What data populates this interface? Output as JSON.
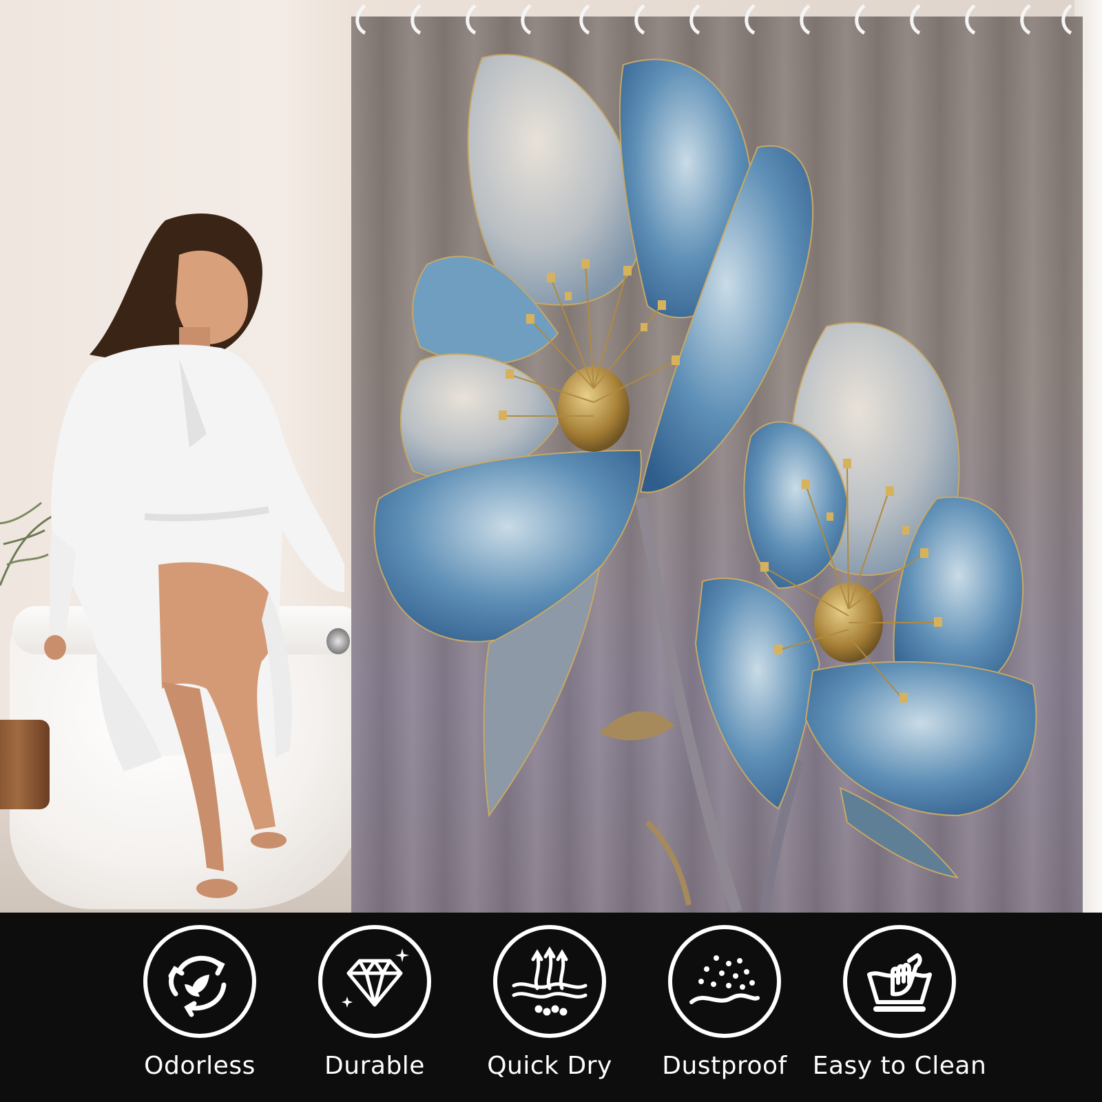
{
  "features": [
    {
      "label": "Odorless",
      "icon": "recycle-leaf-icon"
    },
    {
      "label": "Durable",
      "icon": "diamond-icon"
    },
    {
      "label": "Quick Dry",
      "icon": "quick-dry-icon"
    },
    {
      "label": "Dustproof",
      "icon": "dust-icon"
    },
    {
      "label": "Easy to Clean",
      "icon": "hand-wash-icon"
    }
  ],
  "colors": {
    "band_background": "#0d0d0d",
    "icon_stroke": "#ffffff",
    "petal_blue": "#3f6f9e",
    "gold": "#b8923d",
    "curtain_taupe": "#8a7f7a"
  }
}
